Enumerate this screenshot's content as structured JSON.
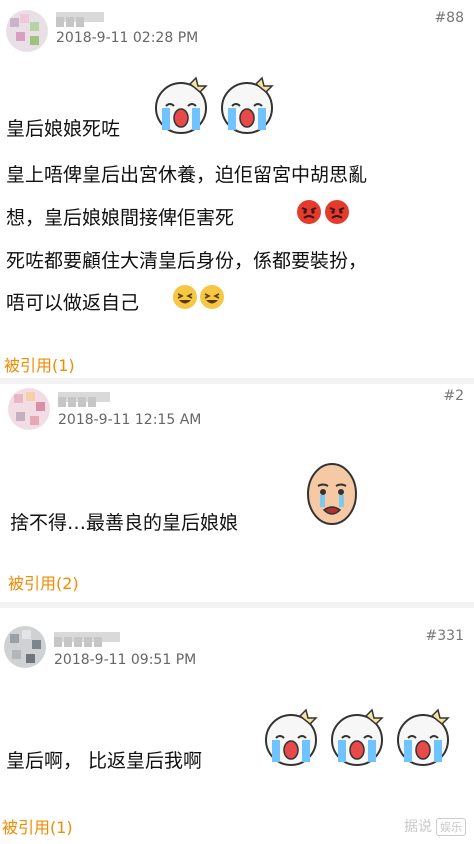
{
  "posts": [
    {
      "floor": "#88",
      "time": "2018-9-11 02:28 PM",
      "lines": [
        "皇后娘娘死咗",
        "皇上唔俾皇后出宮休養，迫佢留宮中胡思亂",
        "想，皇后娘娘間接俾佢害死",
        "死咗都要顧住大清皇后身份，係都要裝扮，",
        "唔可以做返自己"
      ],
      "quote_label": "被引用(1)"
    },
    {
      "floor": "#2",
      "time": "2018-9-11 12:15 AM",
      "lines": [
        "捨不得…最善良的皇后娘娘"
      ],
      "quote_label": "被引用(2)"
    },
    {
      "floor": "#331",
      "time": "2018-9-11 09:51 PM",
      "lines": [
        "皇后啊， 比返皇后我啊"
      ],
      "quote_label": "被引用(1)"
    }
  ],
  "watermark": {
    "text": "据说",
    "badge": "娱乐"
  },
  "colors": {
    "quote": "#f28a00",
    "divider": "#f2f2f2"
  }
}
